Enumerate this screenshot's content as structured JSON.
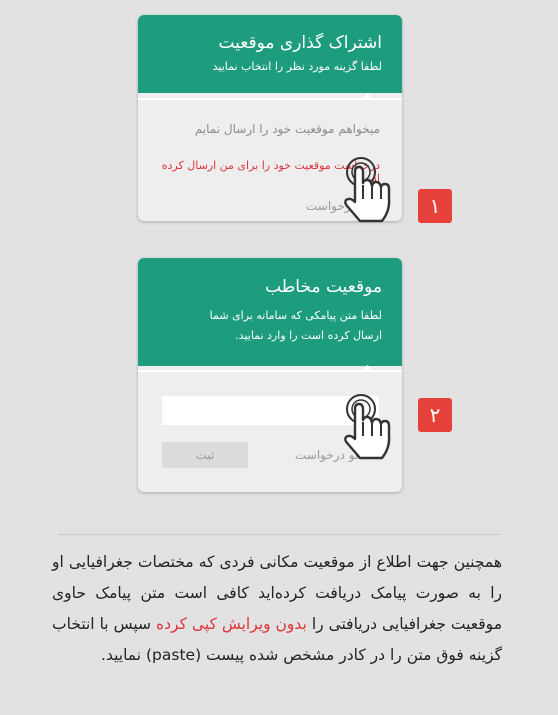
{
  "card1": {
    "title": "اشتراک گذاری موقعیت",
    "subtitle": "لطفا گزینه مورد نظر را انتخاب نمایید",
    "option1": "میخواهم موقعیت خود را ارسال نمایم",
    "option2": "درخواست موقعیت خود را برای من ارسال کرده است",
    "cancel": "لغو درخواست"
  },
  "card2": {
    "title": "موقعیت مخاطب",
    "subtitle_line1": "لطفا متن پیامکی که سامانه برای شما",
    "subtitle_line2": "ارسال کرده است را وارد نمایید.",
    "input_value": "",
    "cancel": "لغو درخواست",
    "submit": "ثبت"
  },
  "badges": {
    "step1": "۱",
    "step2": "۲"
  },
  "paragraph": {
    "part1": "همچنین جهت اطلاع از موقعیت مکانی فردی که مختصات جغرافیایی او را به صورت پیامک دریافت کرده‌اید کافی است متن پیامک حاوی موقعیت جغرافیایی دریافتی را ",
    "highlight": "بدون ویرایش کپی کرده",
    "part2": " سپس با انتخاب گزینه فوق  متن را در کادر مشخص شده پیست (paste) نمایید."
  },
  "colors": {
    "header": "#1e9c7e",
    "accent_red": "#e0333a",
    "badge": "#e6423b"
  },
  "icons": {
    "pointer": "hand-pointer-icon"
  }
}
